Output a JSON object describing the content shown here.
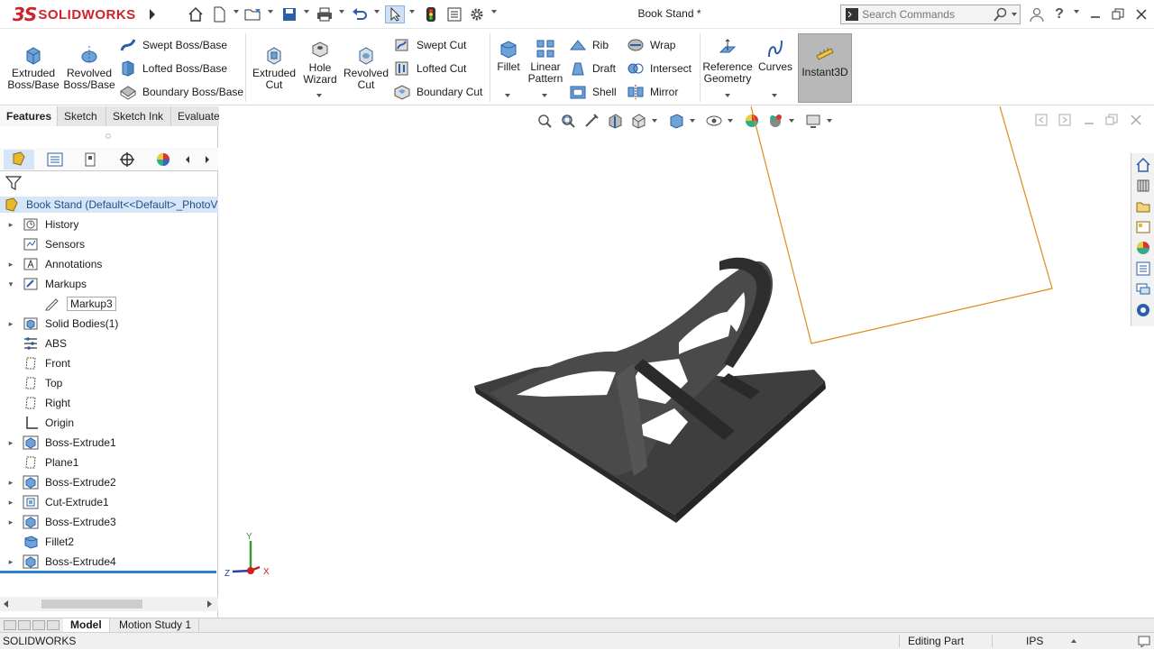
{
  "app": {
    "logo_ds": "3S",
    "logo_text": "SOLIDWORKS",
    "doc_title": "Book Stand *"
  },
  "search": {
    "placeholder": "Search Commands"
  },
  "ribbon": {
    "extruded_boss": [
      "Extruded",
      "Boss/Base"
    ],
    "revolved_boss": [
      "Revolved",
      "Boss/Base"
    ],
    "swept_boss": "Swept Boss/Base",
    "lofted_boss": "Lofted Boss/Base",
    "boundary_boss": "Boundary Boss/Base",
    "extruded_cut": [
      "Extruded",
      "Cut"
    ],
    "hole_wizard": [
      "Hole",
      "Wizard"
    ],
    "revolved_cut": [
      "Revolved",
      "Cut"
    ],
    "swept_cut": "Swept Cut",
    "lofted_cut": "Lofted Cut",
    "boundary_cut": "Boundary Cut",
    "fillet": "Fillet",
    "linear_pattern": [
      "Linear",
      "Pattern"
    ],
    "rib": "Rib",
    "wrap": "Wrap",
    "draft": "Draft",
    "intersect": "Intersect",
    "shell": "Shell",
    "mirror": "Mirror",
    "reference_geometry": [
      "Reference",
      "Geometry"
    ],
    "curves": "Curves",
    "instant3d": "Instant3D"
  },
  "tabs": [
    "Features",
    "Sketch",
    "Sketch Ink",
    "Evaluate"
  ],
  "tree": {
    "root": "Book Stand  (Default<<Default>_PhotoV",
    "items": [
      {
        "label": "History",
        "exp": "▸",
        "icon": "history-icon"
      },
      {
        "label": "Sensors",
        "exp": "",
        "icon": "sensors-icon"
      },
      {
        "label": "Annotations",
        "exp": "▸",
        "icon": "annotations-icon"
      },
      {
        "label": "Markups",
        "exp": "▾",
        "icon": "markups-icon"
      },
      {
        "label": "Markup3",
        "exp": "",
        "icon": "markup-icon"
      },
      {
        "label": "Solid Bodies(1)",
        "exp": "▸",
        "icon": "solid-bodies-icon"
      },
      {
        "label": "ABS",
        "exp": "",
        "icon": "material-icon"
      },
      {
        "label": "Front",
        "exp": "",
        "icon": "plane-icon"
      },
      {
        "label": "Top",
        "exp": "",
        "icon": "plane-icon"
      },
      {
        "label": "Right",
        "exp": "",
        "icon": "plane-icon"
      },
      {
        "label": "Origin",
        "exp": "",
        "icon": "origin-icon"
      },
      {
        "label": "Boss-Extrude1",
        "exp": "▸",
        "icon": "extrude-icon"
      },
      {
        "label": "Plane1",
        "exp": "",
        "icon": "plane-icon"
      },
      {
        "label": "Boss-Extrude2",
        "exp": "▸",
        "icon": "extrude-icon"
      },
      {
        "label": "Cut-Extrude1",
        "exp": "▸",
        "icon": "cut-extrude-icon"
      },
      {
        "label": "Boss-Extrude3",
        "exp": "▸",
        "icon": "extrude-icon"
      },
      {
        "label": "Fillet2",
        "exp": "",
        "icon": "fillet-icon"
      },
      {
        "label": "Boss-Extrude4",
        "exp": "▸",
        "icon": "extrude-icon"
      }
    ]
  },
  "triad": {
    "x": "X",
    "y": "Y",
    "z": "Z"
  },
  "bottom_tabs": [
    "Model",
    "Motion Study 1"
  ],
  "status": {
    "app": "SOLIDWORKS",
    "mode": "Editing Part",
    "units": "IPS"
  },
  "colors": {
    "brand": "#d0222a",
    "selection": "#d6e6f7",
    "accent_blue": "#2a7fd1",
    "sketch_orange": "#e08a1e",
    "model_dark": "#4a4a4a"
  }
}
